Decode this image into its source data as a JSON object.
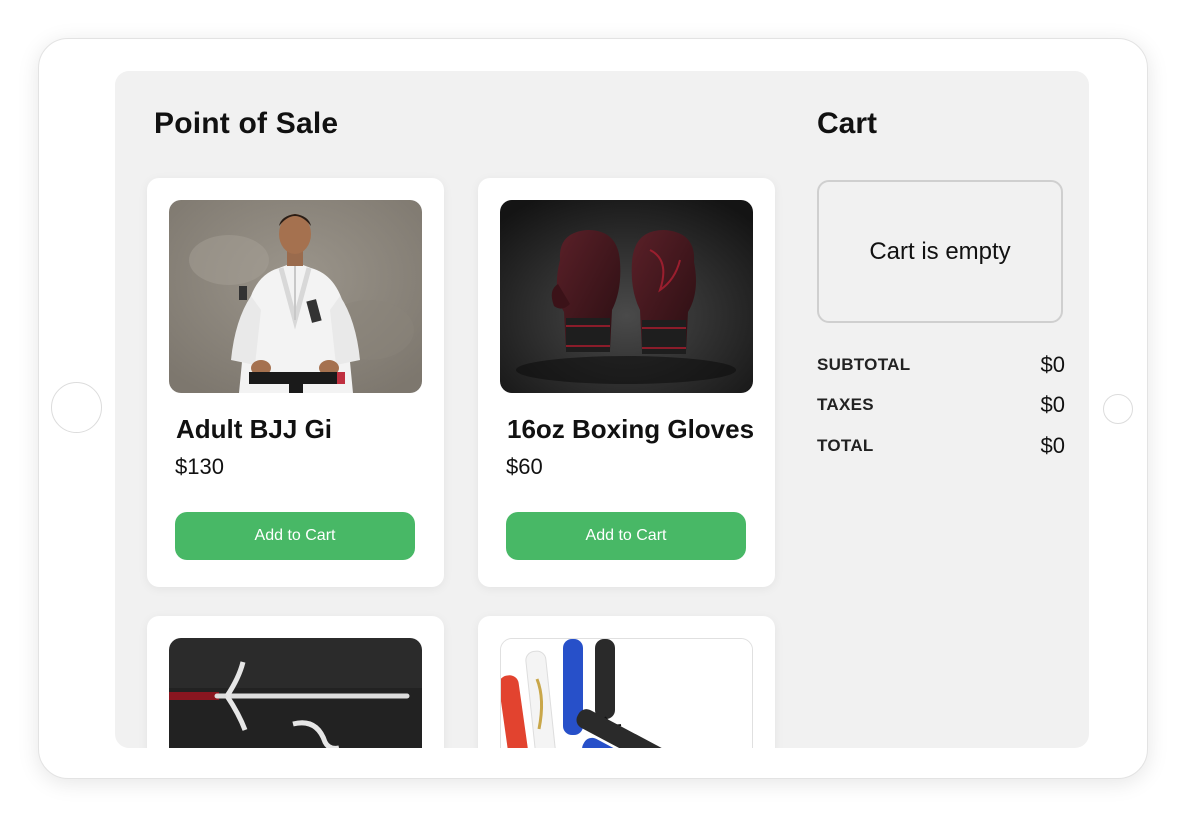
{
  "header": {
    "title": "Point of Sale"
  },
  "products": [
    {
      "name": "Adult BJJ Gi",
      "price": "$130",
      "button_label": "Add to Cart",
      "icon": "gi-photo"
    },
    {
      "name": "16oz Boxing Gloves",
      "price": "$60",
      "button_label": "Add to Cart",
      "icon": "gloves-photo"
    },
    {
      "icon": "sai-photo"
    },
    {
      "icon": "nunchaku-photo"
    }
  ],
  "cart": {
    "title": "Cart",
    "empty_message": "Cart is empty",
    "subtotal_label": "SUBTOTAL",
    "subtotal_value": "$0",
    "taxes_label": "TAXES",
    "taxes_value": "$0",
    "total_label": "TOTAL",
    "total_value": "$0"
  },
  "colors": {
    "accent": "#48b866",
    "screen_bg": "#f1f1f1"
  }
}
